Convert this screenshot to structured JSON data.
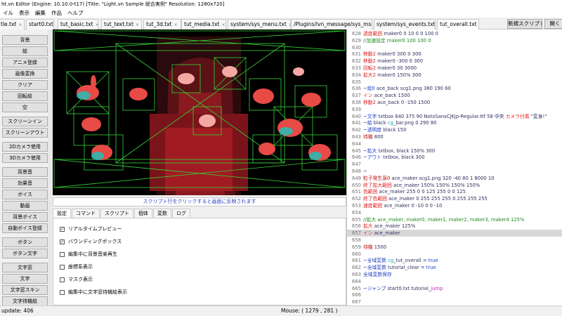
{
  "window": {
    "title": "ht.vn Editor (Engine: 10.10.0-t17) [Title: \"Light.vn Sample 総合実例\" Resolution: 1280x720]"
  },
  "menu": [
    "イル",
    "表示",
    "編集",
    "作品",
    "ヘルプ"
  ],
  "tabs": [
    {
      "label": "tle.txt",
      "active": false
    },
    {
      "label": "start0.txt",
      "active": false
    },
    {
      "label": "tut_basic.txt",
      "active": false
    },
    {
      "label": "tut_text.txt",
      "active": false
    },
    {
      "label": "tut_3d.txt",
      "active": false
    },
    {
      "label": "tut_media.txt",
      "active": false
    },
    {
      "label": "system/sys_menu.txt",
      "active": false
    },
    {
      "label": "/Plugins/lvn_message/sys_msg.txt",
      "active": false
    },
    {
      "label": "system/sys_events.txt",
      "active": false
    },
    {
      "label": "tut_overall.txt",
      "active": true
    }
  ],
  "tab_close": "×",
  "toolbar": {
    "new_script": "新規スクリプト",
    "open": "開く"
  },
  "left_buttons": [
    "背景",
    "絵",
    "アニメ登録",
    "画像変換",
    "クリア",
    "回転絵",
    "空",
    "スクリーンイン",
    "スクリーンアウト",
    "2Dカメラ使用",
    "3Dカメラ使用",
    "背景音",
    "効果音",
    "ボイス",
    "動画",
    "背景ボイス",
    "自動ボイス登録",
    "ボタン",
    "ボタン文字",
    "文字窓",
    "文字",
    "文字窓スキン",
    "文字待機絵"
  ],
  "preview_hint": "スクリプト行をクリックすると画面に反映されます",
  "sub_tabs": [
    {
      "label": "設定",
      "active": true
    },
    {
      "label": "コマンド",
      "active": false
    },
    {
      "label": "スクリプト",
      "active": false
    },
    {
      "label": "個体",
      "active": false
    },
    {
      "label": "変数",
      "active": false
    },
    {
      "label": "ログ",
      "active": false
    }
  ],
  "settings": [
    {
      "label": "リアルタイムプレビュー",
      "checked": true
    },
    {
      "label": "バウンディングボックス",
      "checked": true
    },
    {
      "label": "編集中に背景音楽再生",
      "checked": false
    },
    {
      "label": "座標系表示",
      "checked": false
    },
    {
      "label": "マスク表示",
      "checked": false
    },
    {
      "label": "編集中に文字窓待機絵表示",
      "checked": false
    }
  ],
  "check_mark": "✓",
  "code_lines": [
    {
      "n": "628",
      "parts": [
        {
          "t": "透度範囲",
          "c": "#e02020"
        },
        {
          "t": " maker0 0 10 0 0 100 0",
          "c": "#303060"
        }
      ]
    },
    {
      "n": "629",
      "parts": [
        {
          "t": "//加速設定 maker0 100 100 0",
          "c": "#208a20"
        }
      ]
    },
    {
      "n": "630",
      "parts": []
    },
    {
      "n": "631",
      "parts": [
        {
          "t": "移動2",
          "c": "#e02020"
        },
        {
          "t": " maker0 300 0 300",
          "c": "#303060"
        }
      ]
    },
    {
      "n": "632",
      "parts": [
        {
          "t": "移動2",
          "c": "#e02020"
        },
        {
          "t": " maker0 -300 0 300",
          "c": "#303060"
        }
      ]
    },
    {
      "n": "633",
      "parts": [
        {
          "t": "回転2",
          "c": "#e02020"
        },
        {
          "t": " maker0 30 3000",
          "c": "#303060"
        }
      ]
    },
    {
      "n": "634",
      "parts": [
        {
          "t": "拡大2",
          "c": "#e02020"
        },
        {
          "t": " maker0 150% 300",
          "c": "#303060"
        }
      ]
    },
    {
      "n": "635",
      "parts": []
    },
    {
      "n": "636",
      "parts": [
        {
          "t": "~絵0",
          "c": "#2040c0"
        },
        {
          "t": " ace_back scg1.png 380 190 60",
          "c": "#303060"
        }
      ]
    },
    {
      "n": "637",
      "parts": [
        {
          "t": "イン",
          "c": "#e02020"
        },
        {
          "t": " ace_back 1500",
          "c": "#303060"
        }
      ]
    },
    {
      "n": "638",
      "parts": [
        {
          "t": "移動2",
          "c": "#e02020"
        },
        {
          "t": " ace_back 0 -150 1500",
          "c": "#303060"
        }
      ]
    },
    {
      "n": "639",
      "parts": []
    },
    {
      "n": "640",
      "parts": [
        {
          "t": "~文字",
          "c": "#2040c0"
        },
        {
          "t": " txtbox 640 375 90 NotoSansCJKjp-Regular.ttf 58 中央 ",
          "c": "#303060"
        },
        {
          "t": "カメラ付着",
          "c": "#e02020"
        },
        {
          "t": " \"変身!\"",
          "c": "#303060"
        }
      ]
    },
    {
      "n": "641",
      "parts": [
        {
          "t": "~絵",
          "c": "#2040c0"
        },
        {
          "t": " black ",
          "c": "#303060"
        },
        {
          "t": "cg",
          "c": "#20a0a0"
        },
        {
          "t": "_bar.png 0 290 80",
          "c": "#303060"
        }
      ]
    },
    {
      "n": "642",
      "parts": [
        {
          "t": "~透明度",
          "c": "#2040c0"
        },
        {
          "t": " black 150",
          "c": "#303060"
        }
      ]
    },
    {
      "n": "643",
      "parts": [
        {
          "t": "待機",
          "c": "#c01010"
        },
        {
          "t": " 800",
          "c": "#303060"
        }
      ]
    },
    {
      "n": "644",
      "parts": []
    },
    {
      "n": "645",
      "parts": [
        {
          "t": "~拡大",
          "c": "#2040c0"
        },
        {
          "t": " txtbox, black 150% 300",
          "c": "#303060"
        }
      ]
    },
    {
      "n": "646",
      "parts": [
        {
          "t": "~アウト",
          "c": "#2040c0"
        },
        {
          "t": " txtbox, black 300",
          "c": "#303060"
        }
      ]
    },
    {
      "n": "647",
      "parts": []
    },
    {
      "n": "648",
      "parts": [
        {
          "t": "~",
          "c": "#2040c0"
        }
      ]
    },
    {
      "n": "649",
      "parts": [
        {
          "t": "粒子発生源0",
          "c": "#c01010"
        },
        {
          "t": " ace_maker scg1.png 320 -40 80 1 8000 10",
          "c": "#303060"
        }
      ]
    },
    {
      "n": "650",
      "parts": [
        {
          "t": "終了拡大範囲",
          "c": "#e02020"
        },
        {
          "t": " ace_maker 150% 150% 150% 150%",
          "c": "#303060"
        }
      ]
    },
    {
      "n": "651",
      "parts": [
        {
          "t": "色範囲",
          "c": "#e02020"
        },
        {
          "t": " ace_maker 255 0 0 125 255 0 0 125",
          "c": "#303060"
        }
      ]
    },
    {
      "n": "652",
      "parts": [
        {
          "t": "終了色範囲",
          "c": "#e02020"
        },
        {
          "t": " ace_maker 0 255 255 255 0 255 255 255",
          "c": "#303060"
        }
      ]
    },
    {
      "n": "653",
      "parts": [
        {
          "t": "速度範囲",
          "c": "#e02020"
        },
        {
          "t": " ace_maker 0 -10 0 0 -10",
          "c": "#303060"
        }
      ]
    },
    {
      "n": "654",
      "parts": []
    },
    {
      "n": "655",
      "parts": [
        {
          "t": "//拡大 ace_maker, maker0, maker1, maker2, maker3, maker4 125%",
          "c": "#208a20"
        }
      ]
    },
    {
      "n": "656",
      "parts": [
        {
          "t": "拡大",
          "c": "#e02020"
        },
        {
          "t": " ace_maker 125%",
          "c": "#303060"
        }
      ]
    },
    {
      "n": "657",
      "parts": [
        {
          "t": "イン",
          "c": "#e02020"
        },
        {
          "t": " ace_maker",
          "c": "#303060"
        }
      ],
      "hl": true
    },
    {
      "n": "658",
      "parts": []
    },
    {
      "n": "659",
      "parts": [
        {
          "t": "待機",
          "c": "#c01010"
        },
        {
          "t": " 1500",
          "c": "#303060"
        }
      ]
    },
    {
      "n": "660",
      "parts": []
    },
    {
      "n": "661",
      "parts": [
        {
          "t": "~全域変数",
          "c": "#2040c0"
        },
        {
          "t": " ",
          "c": "#303060"
        },
        {
          "t": "cg",
          "c": "#20a0a0"
        },
        {
          "t": "_tut_overall = ",
          "c": "#303060"
        },
        {
          "t": "true",
          "c": "#2040c0"
        }
      ]
    },
    {
      "n": "662",
      "parts": [
        {
          "t": "~全域変数",
          "c": "#2040c0"
        },
        {
          "t": " tutorial_clear = ",
          "c": "#303060"
        },
        {
          "t": "true",
          "c": "#2040c0"
        }
      ]
    },
    {
      "n": "663",
      "parts": [
        {
          "t": "全域変数保存",
          "c": "#2040c0"
        }
      ]
    },
    {
      "n": "664",
      "parts": []
    },
    {
      "n": "665",
      "parts": [
        {
          "t": "~ジャンプ",
          "c": "#2040c0"
        },
        {
          "t": " start0.txt tutorial_",
          "c": "#303060"
        },
        {
          "t": "jump",
          "c": "#c020c0"
        }
      ]
    },
    {
      "n": "666",
      "parts": []
    },
    {
      "n": "667",
      "parts": []
    }
  ],
  "status": {
    "left": "update: 406",
    "mouse": "Mouse: ( 1279 , 281 )"
  }
}
